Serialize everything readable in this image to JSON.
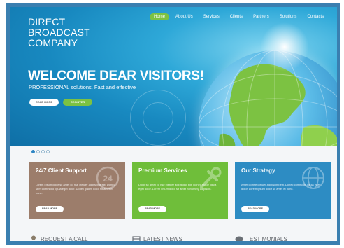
{
  "header": {
    "brand_line1": "DIRECT",
    "brand_line2": "BROADCAST",
    "brand_line3": "COMPANY"
  },
  "nav": {
    "items": [
      {
        "label": "Home",
        "active": true
      },
      {
        "label": "About Us"
      },
      {
        "label": "Services"
      },
      {
        "label": "Clients"
      },
      {
        "label": "Partners"
      },
      {
        "label": "Solutions"
      },
      {
        "label": "Contacts"
      }
    ]
  },
  "hero": {
    "title": "WELCOME DEAR VISITORS!",
    "subtitle": "PROFESSIONAL solutions. Fast and effective",
    "read_more": "READ MORE",
    "register": "REGISTER"
  },
  "slider": {
    "dots": 4,
    "active_index": 0
  },
  "cards": [
    {
      "title": "24/7 Client Support",
      "text": "Lorem ipsum dolor sit amet co nse ctetuer adipiscing elit. Donec sem commodo ligula eget dolor. Donec ipsum dolor sit amet et nunc.",
      "button": "READ MORE",
      "icon": "clock-24-icon",
      "color": "#9c7d6b"
    },
    {
      "title": "Premium Services",
      "text": "Dolor sit amet co nse ctetuer adipiscing elit. Donec mode ligula eget dolor. Lorem ipsum dolor sit amet nonummy adipiscin.",
      "button": "READ MORE",
      "icon": "wrench-icon",
      "color": "#6fbe3a"
    },
    {
      "title": "Our Strategy",
      "text": "Amet co nse ctetuer adipiscing elit. Donec commodo ligula eget dolor. Lorem ipsum dolor sit amet et nunc.",
      "button": "READ MORE",
      "icon": "globe-icon",
      "color": "#2d8cc3"
    }
  ],
  "bottom": {
    "request_call": "REQUEST A CALL",
    "latest_news": "LATEST NEWS",
    "testimonials": "TESTIMONIALS"
  },
  "colors": {
    "frame": "#3a7fb0",
    "accent_green": "#7cc242",
    "hero_blue": "#1889c0"
  }
}
